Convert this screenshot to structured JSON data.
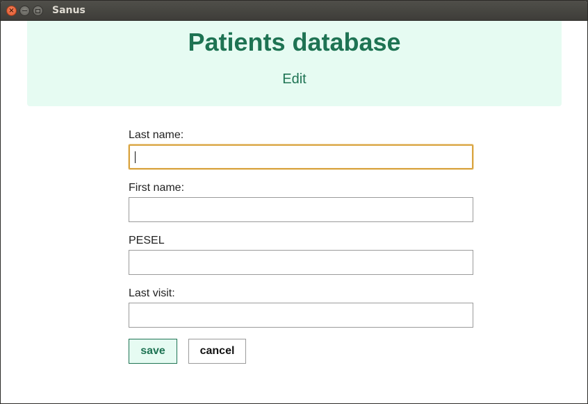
{
  "window": {
    "title": "Sanus",
    "controls": [
      "close-icon",
      "minimize-icon",
      "maximize-icon"
    ]
  },
  "header": {
    "title": "Patients database",
    "subtitle": "Edit"
  },
  "form": {
    "fields": [
      {
        "label": "Last name:",
        "value": "",
        "focused": true
      },
      {
        "label": "First name:",
        "value": ""
      },
      {
        "label": "PESEL",
        "value": ""
      },
      {
        "label": "Last visit:",
        "value": ""
      }
    ],
    "save_label": "save",
    "cancel_label": "cancel"
  },
  "colors": {
    "accent": "#1e7353",
    "header_bg": "#e6fbf2",
    "focus_border": "#d9a441"
  }
}
